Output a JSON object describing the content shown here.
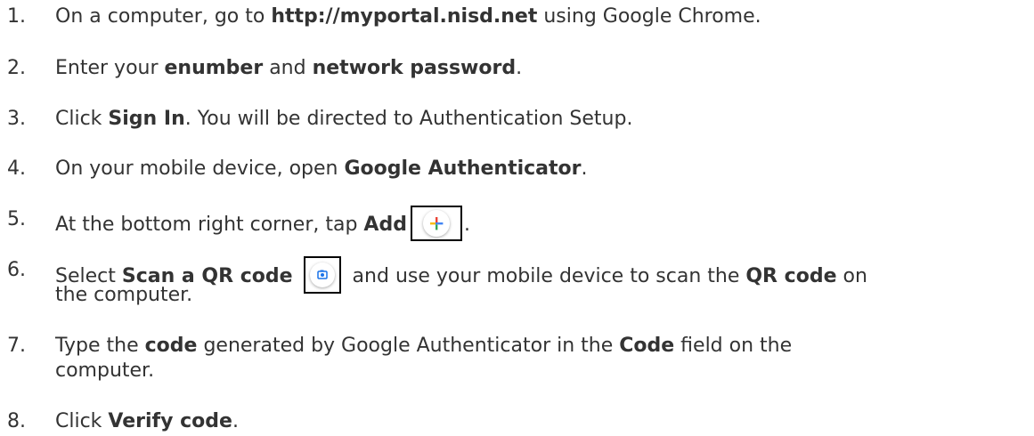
{
  "steps": [
    {
      "number": "1.",
      "parts": {
        "a": "On a computer, go to ",
        "b": "http://myportal.nisd.net",
        "c": " using Google Chrome."
      }
    },
    {
      "number": "2.",
      "parts": {
        "a": "Enter your ",
        "b": "enumber",
        "c": " and ",
        "d": "network password",
        "e": "."
      }
    },
    {
      "number": "3.",
      "parts": {
        "a": "Click ",
        "b": "Sign In",
        "c": ". You will be directed to Authentication Setup."
      }
    },
    {
      "number": "4.",
      "parts": {
        "a": "On your mobile device, open ",
        "b": "Google Authenticator",
        "c": "."
      }
    },
    {
      "number": "5.",
      "parts": {
        "a": "At the bottom right corner, tap ",
        "b": "Add",
        "c": "."
      },
      "icon": "plus-icon"
    },
    {
      "number": "6.",
      "parts": {
        "a": "Select ",
        "b": "Scan a QR code",
        "c": " and use your mobile device to scan the ",
        "d": "QR code",
        "e": " on",
        "f": "the computer."
      },
      "icon": "camera-icon"
    },
    {
      "number": "7.",
      "parts": {
        "a": "Type the ",
        "b": "code",
        "c": " generated by Google Authenticator in the ",
        "d": "Code",
        "e": " field on the",
        "f": "computer."
      }
    },
    {
      "number": "8.",
      "parts": {
        "a": "Click ",
        "b": "Verify code",
        "c": "."
      }
    }
  ],
  "colors": {
    "text": "#333333",
    "google_blue": "#4285F4",
    "google_red": "#EA4335",
    "google_yellow": "#FBBC04",
    "google_green": "#34A853",
    "icon_box_border": "#000000"
  }
}
